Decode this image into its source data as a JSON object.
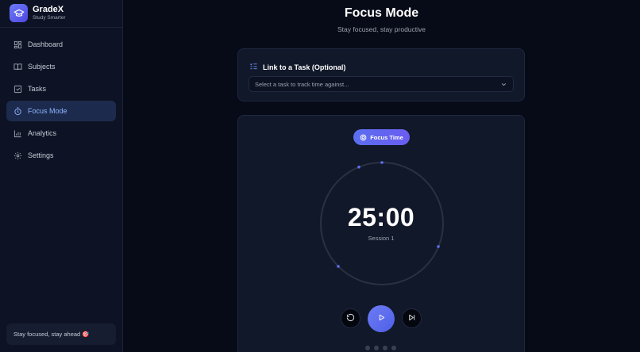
{
  "brand": {
    "name": "GradeX",
    "tagline": "Study Smarter"
  },
  "sidebar": {
    "items": [
      {
        "label": "Dashboard",
        "icon": "dashboard-icon",
        "active": false
      },
      {
        "label": "Subjects",
        "icon": "book-icon",
        "active": false
      },
      {
        "label": "Tasks",
        "icon": "checkbox-icon",
        "active": false
      },
      {
        "label": "Focus Mode",
        "icon": "timer-icon",
        "active": true
      },
      {
        "label": "Analytics",
        "icon": "bar-chart-icon",
        "active": false
      },
      {
        "label": "Settings",
        "icon": "gear-icon",
        "active": false
      }
    ],
    "footer_note": "Stay focused, stay ahead 🎯"
  },
  "page": {
    "title": "Focus Mode",
    "subtitle": "Stay focused, stay productive"
  },
  "task_link": {
    "title": "Link to a Task (Optional)",
    "icon": "list-check-icon",
    "placeholder": "Select a task to track time against..."
  },
  "timer": {
    "mode_label": "Focus Time",
    "time": "25:00",
    "session_label": "Session 1",
    "progress": 0,
    "controls": [
      "reset-icon",
      "play-icon",
      "skip-icon"
    ],
    "session_dots": 4
  },
  "colors": {
    "accent": "#5b6ff0",
    "active_nav_bg": "#1c2b4d",
    "active_nav_text": "#8fb3ff",
    "background": "#070b18"
  }
}
